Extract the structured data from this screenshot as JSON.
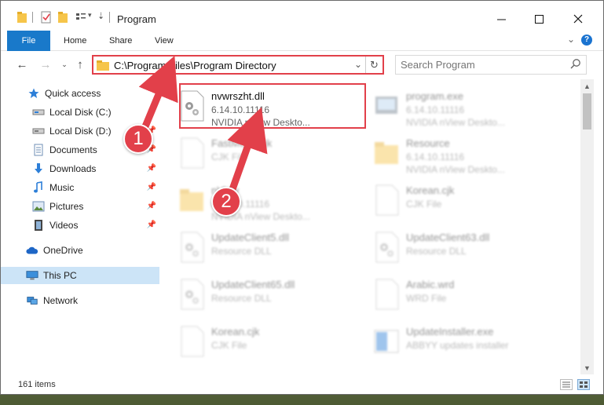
{
  "window": {
    "title": "Program",
    "tabs": [
      "File",
      "Home",
      "Share",
      "View"
    ]
  },
  "address": {
    "path": "C:\\Program Files\\Program Directory"
  },
  "search": {
    "placeholder": "Search Program"
  },
  "sidebar": {
    "items": [
      {
        "label": "Quick access",
        "icon": "star-icon"
      },
      {
        "label": "Local Disk (C:)",
        "icon": "drive-icon"
      },
      {
        "label": "Local Disk (D:)",
        "icon": "drive-icon"
      },
      {
        "label": "Documents",
        "icon": "documents-icon"
      },
      {
        "label": "Downloads",
        "icon": "downloads-icon"
      },
      {
        "label": "Music",
        "icon": "music-icon"
      },
      {
        "label": "Pictures",
        "icon": "pictures-icon"
      },
      {
        "label": "Videos",
        "icon": "videos-icon"
      },
      {
        "label": "OneDrive",
        "icon": "cloud-icon"
      },
      {
        "label": "This PC",
        "icon": "computer-icon"
      },
      {
        "label": "Network",
        "icon": "network-icon"
      }
    ]
  },
  "files": [
    {
      "name": "nvwrszht.dll",
      "line2": "6.14.10.11116",
      "line3": "NVIDIA nView Deskto...",
      "kind": "dll"
    },
    {
      "name": "program.exe",
      "line2": "6.14.10.11116",
      "line3": "NVIDIA nView Deskto...",
      "kind": "exe"
    },
    {
      "name": "FastMenu.cjk",
      "line2": "CJK File",
      "line3": "",
      "kind": "doc"
    },
    {
      "name": "Resource",
      "line2": "6.14.10.11116",
      "line3": "NVIDIA nView Deskto...",
      "kind": "folder"
    },
    {
      "name": "nView",
      "line2": "6.14.10.11116",
      "line3": "NVIDIA nView Deskto...",
      "kind": "folder"
    },
    {
      "name": "Korean.cjk",
      "line2": "CJK File",
      "line3": "",
      "kind": "doc"
    },
    {
      "name": "UpdateClient5.dll",
      "line2": "Resource DLL",
      "line3": "",
      "kind": "dll"
    },
    {
      "name": "UpdateClient63.dll",
      "line2": "Resource DLL",
      "line3": "",
      "kind": "dll"
    },
    {
      "name": "UpdateClient65.dll",
      "line2": "Resource DLL",
      "line3": "",
      "kind": "dll"
    },
    {
      "name": "Arabic.wrd",
      "line2": "WRD File",
      "line3": "",
      "kind": "doc"
    },
    {
      "name": "Korean.cjk",
      "line2": "CJK File",
      "line3": "",
      "kind": "doc"
    },
    {
      "name": "UpdateInstaller.exe",
      "line2": "ABBYY updates installer",
      "line3": "",
      "kind": "installer"
    }
  ],
  "status": {
    "count": "161 items"
  },
  "callouts": [
    "1",
    "2"
  ],
  "colors": {
    "accent": "#1979ca",
    "highlight": "#e2404a",
    "selection": "#cce4f7"
  }
}
